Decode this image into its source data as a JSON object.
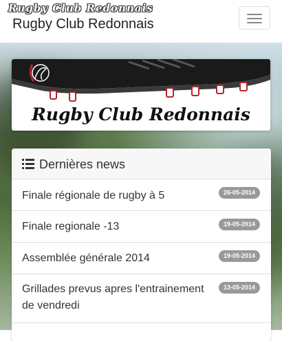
{
  "header": {
    "brand_small": "Rugby Club Redonnais",
    "brand": "Rugby Club Redonnais",
    "menu_icon": "hamburger-icon"
  },
  "banner": {
    "title": "Rugby Club Redonnais"
  },
  "news": {
    "heading": "Dernières news",
    "heading_icon": "list-icon",
    "items": [
      {
        "title": "Finale régionale de rugby à 5",
        "date": "26-05-2014"
      },
      {
        "title": "Finale regionale -13",
        "date": "19-05-2014"
      },
      {
        "title": "Assemblée générale 2014",
        "date": "19-05-2014"
      },
      {
        "title": "Grillades prevus apres l'entrainement de vendredi",
        "date": "13-05-2014"
      }
    ]
  },
  "colors": {
    "badge": "#999999",
    "text": "#333333",
    "boot": "#1a1a1a",
    "stud_accent": "#b3262d"
  }
}
